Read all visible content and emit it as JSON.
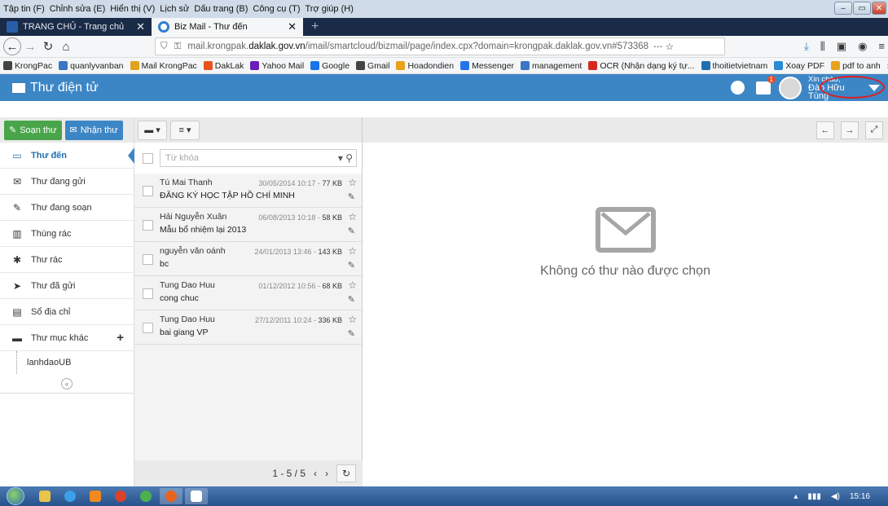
{
  "browser": {
    "menu": [
      "Tập tin (F)",
      "Chỉnh sửa (E)",
      "Hiển thị (V)",
      "Lịch sử",
      "Dấu trang (B)",
      "Công cụ (T)",
      "Trợ giúp (H)"
    ],
    "tabs": [
      {
        "label": "TRANG CHỦ - Trang chủ",
        "favicon_color": "#2b5ea8"
      },
      {
        "label": "Biz Mail - Thư đến",
        "favicon_color": "#2f7fd4"
      }
    ],
    "url_prefix": "mail.krongpak.",
    "url_domain": "daklak.gov.vn",
    "url_rest": "/imail/smartcloud/bizmail/page/index.cpx?domain=krongpak.daklak.gov.vn#573368",
    "bookmarks": [
      {
        "label": "KrongPac",
        "color": "#444"
      },
      {
        "label": "quanlyvanban",
        "color": "#3a76c4"
      },
      {
        "label": "Mail KrongPac",
        "color": "#e0a21c"
      },
      {
        "label": "DakLak",
        "color": "#e8541b"
      },
      {
        "label": "Yahoo Mail",
        "color": "#6a1fb8"
      },
      {
        "label": "Google",
        "color": "#1a73e8"
      },
      {
        "label": "Gmail",
        "color": "#444"
      },
      {
        "label": "Hoadondien",
        "color": "#e8a21b"
      },
      {
        "label": "Messenger",
        "color": "#2575e8"
      },
      {
        "label": "management",
        "color": "#3a76c4"
      },
      {
        "label": "OCR (Nhận dạng ký tự...",
        "color": "#d42a1e"
      },
      {
        "label": "thoitietvietnam",
        "color": "#1f6fb2"
      },
      {
        "label": "Xoay PDF",
        "color": "#2a8ad4"
      },
      {
        "label": "pdf to anh",
        "color": "#e8a21b"
      }
    ]
  },
  "app": {
    "title": "Thư điện tử",
    "greeting": "Xin chào,",
    "user": "Đào Hữu Tùng",
    "notification_count": "1"
  },
  "sidebar": {
    "compose": "Soạn thư",
    "receive": "Nhận thư",
    "folders": [
      {
        "label": "Thư đến",
        "icon": "inbox-icon",
        "glyph": "▭"
      },
      {
        "label": "Thư đang gửi",
        "icon": "envelope-icon",
        "glyph": "✉"
      },
      {
        "label": "Thư đang soạn",
        "icon": "pencil-icon",
        "glyph": "✎"
      },
      {
        "label": "Thùng rác",
        "icon": "trash-icon",
        "glyph": "▥"
      },
      {
        "label": "Thư rác",
        "icon": "bug-icon",
        "glyph": "✱"
      },
      {
        "label": "Thư đã gửi",
        "icon": "send-icon",
        "glyph": "➤"
      },
      {
        "label": "Sổ địa chỉ",
        "icon": "book-icon",
        "glyph": "▤"
      },
      {
        "label": "Thư mục khác",
        "icon": "folder-icon",
        "glyph": "▬"
      }
    ],
    "subfolder": "lanhdaoUB"
  },
  "list": {
    "search_placeholder": "Từ khóa",
    "mails": [
      {
        "sender": "Tú Mai Thanh",
        "date": "30/05/2014 10:17 -",
        "size": "77 KB",
        "subject": "ĐĂNG KÝ HỌC TẬP HỒ CHÍ MINH"
      },
      {
        "sender": "Hải Nguyễn Xuân",
        "date": "06/08/2013 10:18 -",
        "size": "58 KB",
        "subject": "Mẫu bổ nhiệm lại 2013"
      },
      {
        "sender": "nguyễn văn oánh",
        "date": "24/01/2013 13:46 -",
        "size": "143 KB",
        "subject": "bc"
      },
      {
        "sender": "Tung Dao Huu",
        "date": "01/12/2012 10:56 -",
        "size": "68 KB",
        "subject": "cong chuc"
      },
      {
        "sender": "Tung Dao Huu",
        "date": "27/12/2011 10:24 -",
        "size": "336 KB",
        "subject": "bai giang VP"
      }
    ],
    "pagination": "1 - 5 / 5"
  },
  "reader": {
    "empty_text": "Không có thư nào được chọn"
  },
  "taskbar": {
    "time": "15:16"
  }
}
